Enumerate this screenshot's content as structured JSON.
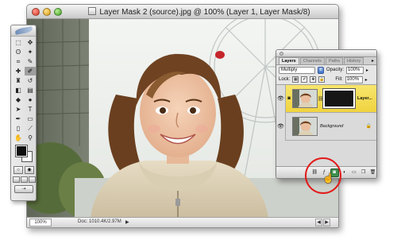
{
  "document": {
    "title": "Layer Mask 2 (source).jpg @ 100% (Layer 1, Layer Mask/8)",
    "status": {
      "zoom": "100%",
      "doc_size": "Doc: 1010.4K/2.97M",
      "menu_arrow": "▶"
    }
  },
  "tools": {
    "items": [
      {
        "name": "marquee-tool",
        "glyph": "⬚"
      },
      {
        "name": "move-tool",
        "glyph": "✥"
      },
      {
        "name": "lasso-tool",
        "glyph": "ʘ"
      },
      {
        "name": "magic-wand-tool",
        "glyph": "✦"
      },
      {
        "name": "crop-tool",
        "glyph": "⌗"
      },
      {
        "name": "slice-tool",
        "glyph": "✎"
      },
      {
        "name": "healing-brush-tool",
        "glyph": "✚"
      },
      {
        "name": "brush-tool",
        "glyph": "✐"
      },
      {
        "name": "clone-stamp-tool",
        "glyph": "♜"
      },
      {
        "name": "history-brush-tool",
        "glyph": "↺"
      },
      {
        "name": "eraser-tool",
        "glyph": "◧"
      },
      {
        "name": "gradient-tool",
        "glyph": "▤"
      },
      {
        "name": "blur-tool",
        "glyph": "◆"
      },
      {
        "name": "dodge-tool",
        "glyph": "●"
      },
      {
        "name": "path-selection-tool",
        "glyph": "➤"
      },
      {
        "name": "type-tool",
        "glyph": "T"
      },
      {
        "name": "pen-tool",
        "glyph": "✒"
      },
      {
        "name": "shape-tool",
        "glyph": "▭"
      },
      {
        "name": "notes-tool",
        "glyph": "▯"
      },
      {
        "name": "eyedropper-tool",
        "glyph": "⟋"
      },
      {
        "name": "hand-tool",
        "glyph": "✋"
      },
      {
        "name": "zoom-tool",
        "glyph": "⚲"
      }
    ],
    "active": "brush-tool",
    "foreground_color": "#101010",
    "background_color": "#ffffff"
  },
  "layers_panel": {
    "tabs": [
      "Layers",
      "Channels",
      "Paths",
      "History"
    ],
    "blend_mode": "Multiply",
    "opacity_label": "Opacity:",
    "opacity": "100%",
    "lock_label": "Lock:",
    "fill_label": "Fill:",
    "fill": "100%",
    "layers": [
      {
        "name": "Layer...",
        "selected": true,
        "has_mask": true
      },
      {
        "name": "Background",
        "selected": false,
        "locked": true
      }
    ],
    "footer_buttons": [
      "link-icon",
      "layer-style-icon",
      "add-layer-mask-icon",
      "adjustment-layer-icon",
      "group-icon",
      "new-layer-icon",
      "trash-icon"
    ]
  },
  "colors": {
    "highlight_ring": "#e21a1a",
    "selected_layer": "#f0d33f"
  }
}
